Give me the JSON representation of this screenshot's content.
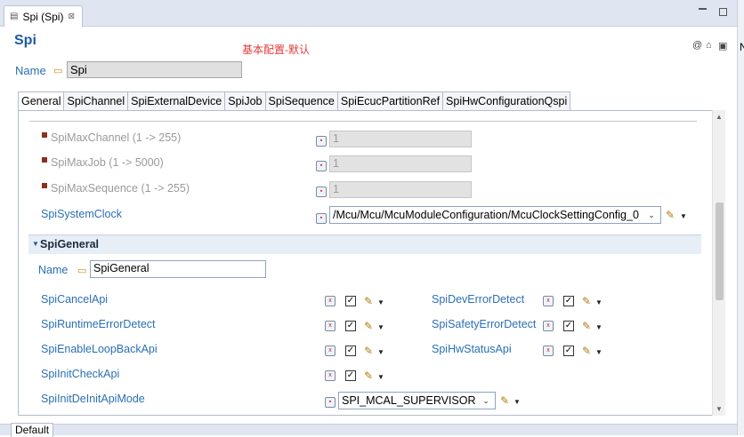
{
  "editor_tab": {
    "label": "Spi (Spi)",
    "close": "⊠"
  },
  "header": {
    "title": "Spi",
    "note": "基本配置-默认"
  },
  "name_row": {
    "label": "Name",
    "value": "Spi"
  },
  "tabs": [
    {
      "label": "General"
    },
    {
      "label": "SpiChannel"
    },
    {
      "label": "SpiExternalDevice"
    },
    {
      "label": "SpiJob"
    },
    {
      "label": "SpiSequence"
    },
    {
      "label": "SpiEcucPartitionRef"
    },
    {
      "label": "SpiHwConfigurationQspi"
    }
  ],
  "general": {
    "max_channel": {
      "label": "SpiMaxChannel (1 -> 255)",
      "value": "1"
    },
    "max_job": {
      "label": "SpiMaxJob (1 -> 5000)",
      "value": "1"
    },
    "max_sequence": {
      "label": "SpiMaxSequence (1 -> 255)",
      "value": "1"
    },
    "system_clock": {
      "label": "SpiSystemClock",
      "value": "/Mcu/Mcu/McuModuleConfiguration/McuClockSettingConfig_0"
    }
  },
  "spi_general": {
    "title": "SpiGeneral",
    "name_label": "Name",
    "name_value": "SpiGeneral",
    "params_left": [
      {
        "label": "SpiCancelApi",
        "checked": "✓"
      },
      {
        "label": "SpiRuntimeErrorDetect",
        "checked": "✓"
      },
      {
        "label": "SpiEnableLoopBackApi",
        "checked": "✓"
      },
      {
        "label": "SpiInitCheckApi",
        "checked": "✓"
      }
    ],
    "params_right": [
      {
        "label": "SpiDevErrorDetect",
        "checked": "✓"
      },
      {
        "label": "SpiSafetyErrorDetect",
        "checked": "✓"
      },
      {
        "label": "SpiHwStatusApi",
        "checked": "✓"
      }
    ],
    "init_mode": {
      "label": "SpiInitDeInitApiMode",
      "value": "SPI_MCAL_SUPERVISOR"
    }
  },
  "bottom_tab": {
    "label": "Default"
  },
  "right_strip": {
    "letter": "N"
  },
  "colors": {
    "link": "#2a6fb3",
    "accent": "#1c5a9e",
    "note": "#e23a3a"
  }
}
